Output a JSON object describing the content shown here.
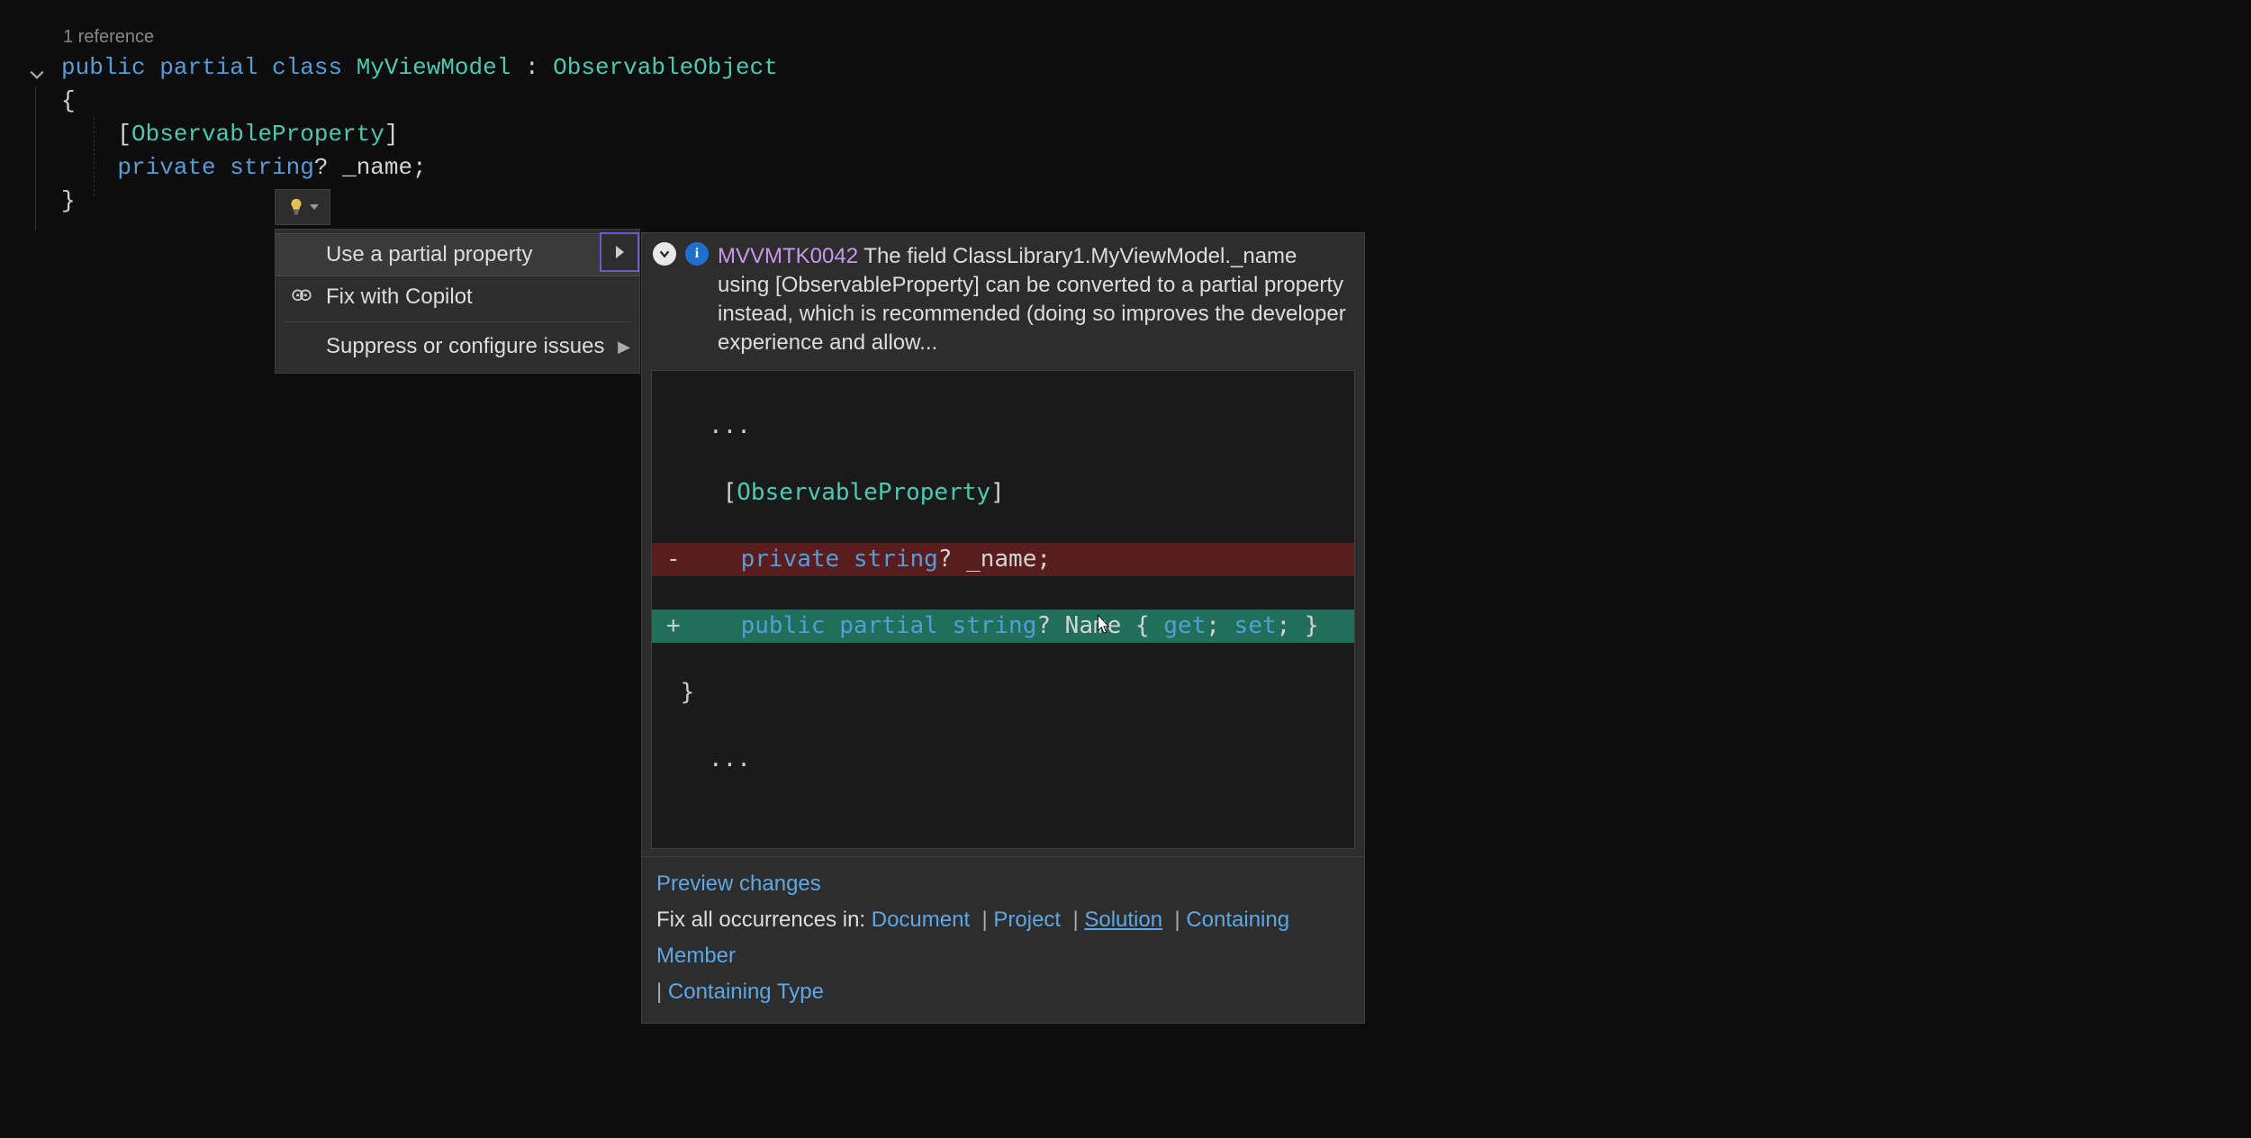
{
  "codelens": "1 reference",
  "code": {
    "line1": {
      "kw_public": "public",
      "kw_partial": "partial",
      "kw_class": "class",
      "name": "MyViewModel",
      "colon": ":",
      "base": "ObservableObject"
    },
    "brace_open": "{",
    "attr_open": "[",
    "attr_name": "ObservableProperty",
    "attr_close": "]",
    "line3": {
      "kw_private": "private",
      "kw_string": "string",
      "q": "?",
      "ident": "_name",
      "semi": ";"
    },
    "brace_close": "}"
  },
  "lightbulb_icon": "lightbulb-icon",
  "actions": {
    "item1": "Use a partial property",
    "item2": "Fix with Copilot",
    "item3": "Suppress or configure issues"
  },
  "diagnostic": {
    "code": "MVVMTK0042",
    "text": "The field ClassLibrary1.MyViewModel._name using [ObservableProperty] can be converted to a partial property instead, which is recommended (doing so improves the developer experience and allow..."
  },
  "diff": {
    "dots": "...",
    "attr": "    [ObservableProperty]",
    "del_line": {
      "pre": "    ",
      "kw1": "private",
      "sp": " ",
      "kw2": "string",
      "q": "?",
      "sp2": " ",
      "name": "_name",
      "semi": ";"
    },
    "add_line": {
      "pre": "    ",
      "kw1": "public",
      "sp": " ",
      "kw2": "partial",
      "sp2": " ",
      "kw3": "string",
      "q": "?",
      "sp3": " ",
      "name": "Name",
      "sp4": " ",
      "b1": "{",
      "sp5": " ",
      "get": "get",
      "s1": ";",
      "sp6": " ",
      "set": "set",
      "s2": ";",
      "sp7": " ",
      "b2": "}"
    },
    "brace": "}",
    "dots2": "..."
  },
  "footer": {
    "preview": "Preview changes",
    "fix_label": "Fix all occurrences in:",
    "doc": "Document",
    "proj": "Project",
    "sol": "Solution",
    "member": "Containing Member",
    "type": "Containing Type",
    "sep": "|"
  }
}
